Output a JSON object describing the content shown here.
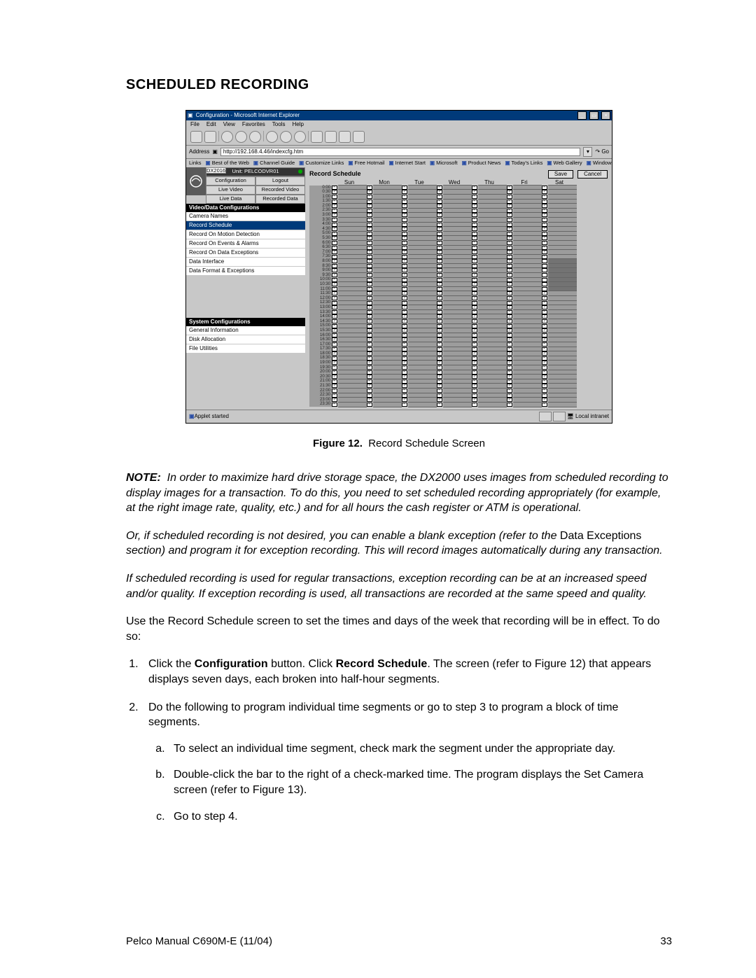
{
  "heading": "SCHEDULED RECORDING",
  "caption": {
    "label": "Figure 12.",
    "text": "Record Schedule Screen"
  },
  "footer": {
    "left": "Pelco Manual C690M-E (11/04)",
    "right": "33"
  },
  "ie": {
    "title": "Configuration - Microsoft Internet Explorer",
    "menubar": [
      "File",
      "Edit",
      "View",
      "Favorites",
      "Tools",
      "Help"
    ],
    "address_label": "Address",
    "address": "http://192.168.4.46/indexcfg.htm",
    "go": "Go",
    "links_label": "Links",
    "links": [
      "Best of the Web",
      "Channel Guide",
      "Customize Links",
      "Free Hotmail",
      "Internet Start",
      "Microsoft",
      "Product News",
      "Today's Links",
      "Web Gallery",
      "Windows Media"
    ],
    "status_left": "Applet started",
    "status_right": "Local intranet"
  },
  "sidebar": {
    "unit": "Unit: PELCODVR01",
    "model": "DX2016",
    "btns": [
      "Configuration",
      "Logout",
      "Live Video",
      "Recorded Video",
      "Live Data",
      "Recorded Data"
    ],
    "sec1_hdr": "Video/Data Configurations",
    "sec1_items": [
      "Camera Names",
      "Record Schedule",
      "Record On Motion Detection",
      "Record On Events & Alarms",
      "Record On Data Exceptions",
      "Data Interface",
      "Data Format & Exceptions"
    ],
    "sec1_selected": 1,
    "sec2_hdr": "System Configurations",
    "sec2_items": [
      "General Information",
      "Disk Allocation",
      "File Utilities"
    ]
  },
  "schedule": {
    "title": "Record Schedule",
    "save": "Save",
    "cancel": "Cancel",
    "days": [
      "Sun",
      "Mon",
      "Tue",
      "Wed",
      "Thu",
      "Fri",
      "Sat"
    ],
    "times": [
      "0:00",
      "0:30",
      "1:00",
      "1:30",
      "2:00",
      "2:30",
      "3:00",
      "3:30",
      "4:00",
      "4:30",
      "5:00",
      "5:30",
      "6:00",
      "6:30",
      "7:00",
      "7:30",
      "8:00",
      "8:30",
      "9:00",
      "9:30",
      "10:00",
      "10:30",
      "11:00",
      "11:30",
      "12:00",
      "12:30",
      "13:00",
      "13:30",
      "14:00",
      "14:30",
      "15:00",
      "15:30",
      "16:00",
      "16:30",
      "17:00",
      "17:30",
      "18:00",
      "18:30",
      "19:00",
      "19:30",
      "20:00",
      "20:30",
      "21:00",
      "21:30",
      "22:00",
      "22:30",
      "23:00",
      "23:30"
    ]
  },
  "body": {
    "note_label": "NOTE:",
    "note": "In order to maximize hard drive storage space, the DX2000 uses images from scheduled recording to display images for a transaction. To do this, you need to set scheduled recording appropriately (for example, at the right image rate, quality, etc.) and for all hours the cash register or ATM is operational.",
    "p2a": "Or, if scheduled recording is not desired, you can enable a blank exception (refer to the ",
    "p2b": "Data Exceptions",
    "p2c": " section) and program it for exception recording. This will record images automatically during any transaction.",
    "p3": "If scheduled recording is used for regular transactions, exception recording can be at an increased speed and/or quality. If exception recording is used, all transactions are recorded at the same speed and quality.",
    "p4": "Use the Record Schedule screen to set the times and days of the week that recording will be in effect. To do so:",
    "s1a": "Click the ",
    "s1b": "Configuration",
    "s1c": " button. Click ",
    "s1d": "Record Schedule",
    "s1e": ". The screen (refer to Figure 12) that appears displays seven days, each broken into half-hour segments.",
    "s2": "Do the following to program individual time segments or go to step 3 to program a block of time segments.",
    "s2a": "To select an individual time segment, check mark the segment under the appropriate day.",
    "s2b": "Double-click the bar to the right of a check-marked time. The program displays the Set Camera screen (refer to Figure 13).",
    "s2c": "Go to step 4."
  }
}
